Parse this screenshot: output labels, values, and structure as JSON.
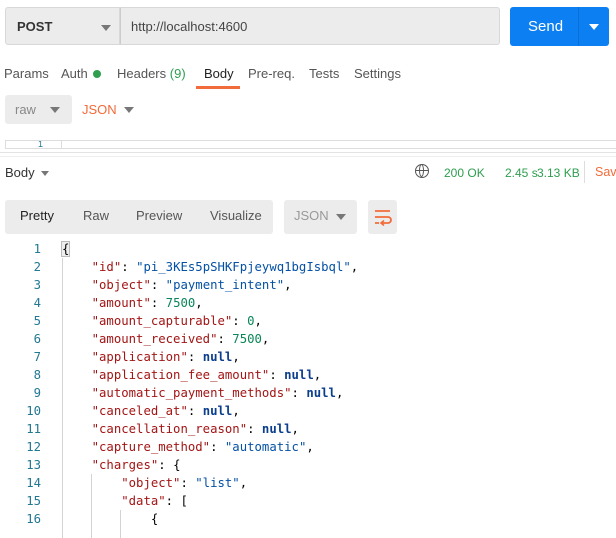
{
  "request": {
    "method": "POST",
    "url": "http://localhost:4600",
    "send_label": "Send"
  },
  "tabs": [
    {
      "label": "Params"
    },
    {
      "label": "Auth"
    },
    {
      "label": "Headers",
      "count": "(9)"
    },
    {
      "label": "Body",
      "active": true
    },
    {
      "label": "Pre-req."
    },
    {
      "label": "Tests"
    },
    {
      "label": "Settings"
    }
  ],
  "body_options": {
    "mode": "raw",
    "format": "JSON"
  },
  "request_editor": {
    "line": "1"
  },
  "response": {
    "title": "Body",
    "status": "200 OK",
    "time": "2.45 s",
    "size": "3.13 KB",
    "save_label": "Save",
    "views": [
      "Pretty",
      "Raw",
      "Preview",
      "Visualize"
    ],
    "active_view": "Pretty",
    "format": "JSON"
  },
  "colors": {
    "accent": "#f26b3a",
    "send": "#0c7ff2",
    "ok": "#2e9e4f"
  },
  "code_lines": [
    [
      [
        "p",
        "{"
      ]
    ],
    [
      [
        "p",
        "    "
      ],
      [
        "k",
        "\"id\""
      ],
      [
        "p",
        ": "
      ],
      [
        "s",
        "\"pi_3KEs5pSHKFpjeywq1bgIsbql\""
      ],
      [
        "p",
        ","
      ]
    ],
    [
      [
        "p",
        "    "
      ],
      [
        "k",
        "\"object\""
      ],
      [
        "p",
        ": "
      ],
      [
        "s",
        "\"payment_intent\""
      ],
      [
        "p",
        ","
      ]
    ],
    [
      [
        "p",
        "    "
      ],
      [
        "k",
        "\"amount\""
      ],
      [
        "p",
        ": "
      ],
      [
        "n",
        "7500"
      ],
      [
        "p",
        ","
      ]
    ],
    [
      [
        "p",
        "    "
      ],
      [
        "k",
        "\"amount_capturable\""
      ],
      [
        "p",
        ": "
      ],
      [
        "n",
        "0"
      ],
      [
        "p",
        ","
      ]
    ],
    [
      [
        "p",
        "    "
      ],
      [
        "k",
        "\"amount_received\""
      ],
      [
        "p",
        ": "
      ],
      [
        "n",
        "7500"
      ],
      [
        "p",
        ","
      ]
    ],
    [
      [
        "p",
        "    "
      ],
      [
        "k",
        "\"application\""
      ],
      [
        "p",
        ": "
      ],
      [
        "b",
        "null"
      ],
      [
        "p",
        ","
      ]
    ],
    [
      [
        "p",
        "    "
      ],
      [
        "k",
        "\"application_fee_amount\""
      ],
      [
        "p",
        ": "
      ],
      [
        "b",
        "null"
      ],
      [
        "p",
        ","
      ]
    ],
    [
      [
        "p",
        "    "
      ],
      [
        "k",
        "\"automatic_payment_methods\""
      ],
      [
        "p",
        ": "
      ],
      [
        "b",
        "null"
      ],
      [
        "p",
        ","
      ]
    ],
    [
      [
        "p",
        "    "
      ],
      [
        "k",
        "\"canceled_at\""
      ],
      [
        "p",
        ": "
      ],
      [
        "b",
        "null"
      ],
      [
        "p",
        ","
      ]
    ],
    [
      [
        "p",
        "    "
      ],
      [
        "k",
        "\"cancellation_reason\""
      ],
      [
        "p",
        ": "
      ],
      [
        "b",
        "null"
      ],
      [
        "p",
        ","
      ]
    ],
    [
      [
        "p",
        "    "
      ],
      [
        "k",
        "\"capture_method\""
      ],
      [
        "p",
        ": "
      ],
      [
        "s",
        "\"automatic\""
      ],
      [
        "p",
        ","
      ]
    ],
    [
      [
        "p",
        "    "
      ],
      [
        "k",
        "\"charges\""
      ],
      [
        "p",
        ": {"
      ]
    ],
    [
      [
        "p",
        "        "
      ],
      [
        "k",
        "\"object\""
      ],
      [
        "p",
        ": "
      ],
      [
        "s",
        "\"list\""
      ],
      [
        "p",
        ","
      ]
    ],
    [
      [
        "p",
        "        "
      ],
      [
        "k",
        "\"data\""
      ],
      [
        "p",
        ": ["
      ]
    ],
    [
      [
        "p",
        "            {"
      ]
    ]
  ]
}
